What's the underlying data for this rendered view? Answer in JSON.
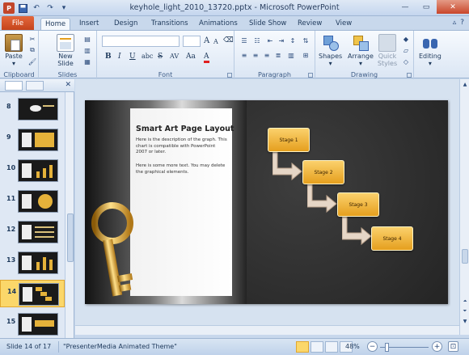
{
  "window": {
    "title": "keyhole_light_2010_13720.pptx - Microsoft PowerPoint"
  },
  "ribbon": {
    "file_tab": "File",
    "tabs": [
      "Home",
      "Insert",
      "Design",
      "Transitions",
      "Animations",
      "Slide Show",
      "Review",
      "View"
    ],
    "active_tab": "Home",
    "clipboard": {
      "paste_label": "Paste",
      "group_label": "Clipboard"
    },
    "slides": {
      "new_slide_label": "New Slide",
      "group_label": "Slides"
    },
    "font": {
      "group_label": "Font",
      "bold": "B",
      "italic": "I",
      "underline": "U",
      "strike": "S",
      "shadow": "abc",
      "spacing": "AV",
      "case": "Aa",
      "color": "A",
      "grow": "A",
      "shrink": "A"
    },
    "paragraph": {
      "group_label": "Paragraph"
    },
    "drawing": {
      "shapes_label": "Shapes",
      "arrange_label": "Arrange",
      "quick_styles_label": "Quick Styles",
      "group_label": "Drawing"
    },
    "editing": {
      "label": "Editing"
    }
  },
  "slides_panel": {
    "thumbnails": [
      {
        "number": "8"
      },
      {
        "number": "9"
      },
      {
        "number": "10"
      },
      {
        "number": "11"
      },
      {
        "number": "12"
      },
      {
        "number": "13"
      },
      {
        "number": "14",
        "selected": true
      },
      {
        "number": "15"
      }
    ]
  },
  "slide": {
    "title": "Smart Art Page Layout",
    "paragraph1": "Here is the description of the graph. This chart is compatible with PowerPoint 2007 or later.",
    "paragraph2": "Here is some more text.  You may delete  the graphical elements.",
    "stages": [
      "Stage 1",
      "Stage 2",
      "Stage 3",
      "Stage 4"
    ],
    "stage_color": "#f0b83a",
    "background_color": "#2a2a2a"
  },
  "statusbar": {
    "slide_indicator": "Slide 14 of 17",
    "theme": "\"PresenterMedia Animated Theme\"",
    "zoom": "48%",
    "zoom_out": "−",
    "zoom_in": "+"
  }
}
